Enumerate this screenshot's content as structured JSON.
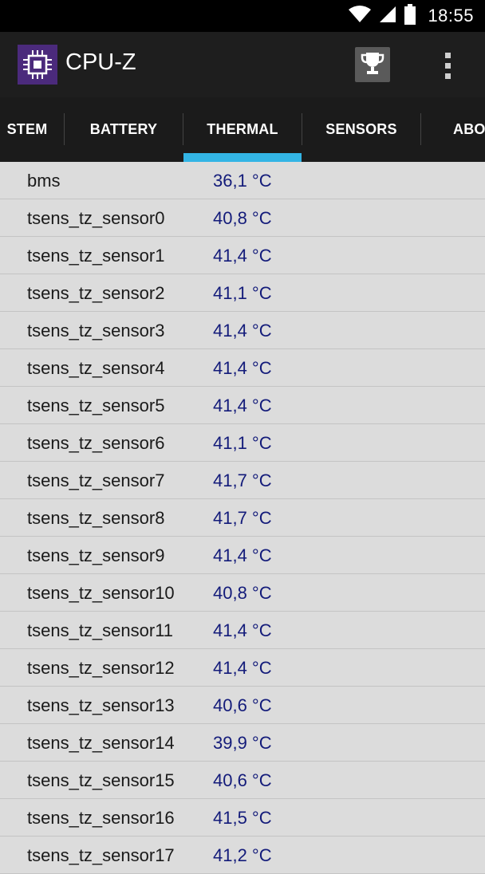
{
  "status_bar": {
    "time": "18:55",
    "icons": [
      "wifi-icon",
      "cell-signal-icon",
      "battery-icon"
    ]
  },
  "app_bar": {
    "title": "CPU-Z",
    "logo_icon": "cpu-chip-icon",
    "actions": [
      "trophy-icon",
      "overflow-menu-icon"
    ],
    "colors": {
      "logo_bg": "#4b2a7c",
      "accent": "#33b5e5"
    }
  },
  "tabs": [
    {
      "label": "STEM"
    },
    {
      "label": "BATTERY"
    },
    {
      "label": "THERMAL",
      "selected": true
    },
    {
      "label": "SENSORS"
    },
    {
      "label": "ABO"
    }
  ],
  "thermal": [
    {
      "name": "bms",
      "value": "36,1 °C"
    },
    {
      "name": "tsens_tz_sensor0",
      "value": "40,8 °C"
    },
    {
      "name": "tsens_tz_sensor1",
      "value": "41,4 °C"
    },
    {
      "name": "tsens_tz_sensor2",
      "value": "41,1 °C"
    },
    {
      "name": "tsens_tz_sensor3",
      "value": "41,4 °C"
    },
    {
      "name": "tsens_tz_sensor4",
      "value": "41,4 °C"
    },
    {
      "name": "tsens_tz_sensor5",
      "value": "41,4 °C"
    },
    {
      "name": "tsens_tz_sensor6",
      "value": "41,1 °C"
    },
    {
      "name": "tsens_tz_sensor7",
      "value": "41,7 °C"
    },
    {
      "name": "tsens_tz_sensor8",
      "value": "41,7 °C"
    },
    {
      "name": "tsens_tz_sensor9",
      "value": "41,4 °C"
    },
    {
      "name": "tsens_tz_sensor10",
      "value": "40,8 °C"
    },
    {
      "name": "tsens_tz_sensor11",
      "value": "41,4 °C"
    },
    {
      "name": "tsens_tz_sensor12",
      "value": "41,4 °C"
    },
    {
      "name": "tsens_tz_sensor13",
      "value": "40,6 °C"
    },
    {
      "name": "tsens_tz_sensor14",
      "value": "39,9 °C"
    },
    {
      "name": "tsens_tz_sensor15",
      "value": "40,6 °C"
    },
    {
      "name": "tsens_tz_sensor16",
      "value": "41,5 °C"
    },
    {
      "name": "tsens_tz_sensor17",
      "value": "41,2 °C"
    }
  ]
}
